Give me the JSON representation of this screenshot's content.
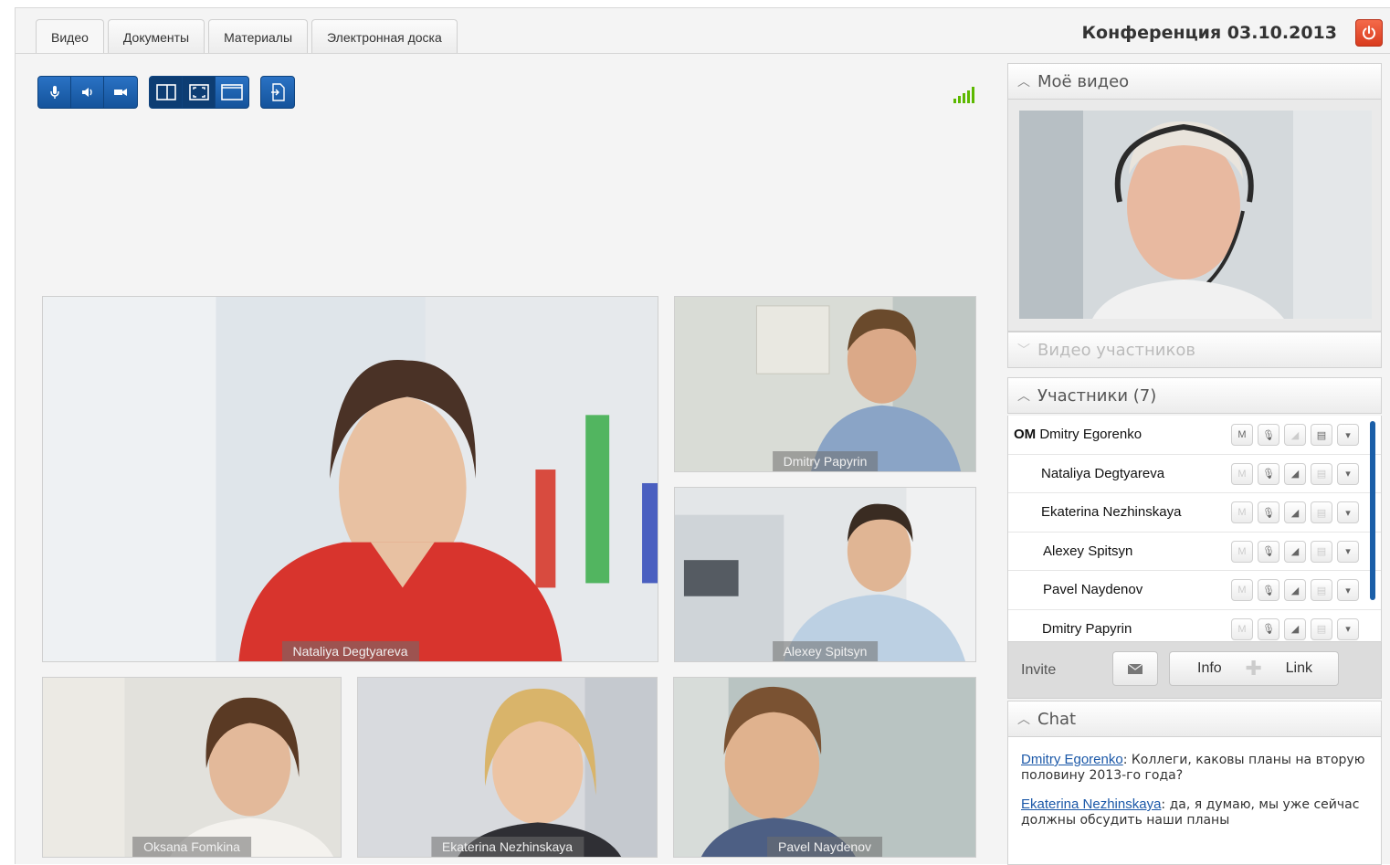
{
  "tabs": [
    {
      "label": "Видео"
    },
    {
      "label": "Документы"
    },
    {
      "label": "Материалы"
    },
    {
      "label": "Электронная доска"
    }
  ],
  "conference_title": "Конференция 03.10.2013",
  "videos": [
    {
      "name": "Nataliya Degtyareva"
    },
    {
      "name": "Dmitry Papyrin"
    },
    {
      "name": "Alexey Spitsyn"
    },
    {
      "name": "Oksana Fomkina"
    },
    {
      "name": "Ekaterina Nezhinskaya"
    },
    {
      "name": "Pavel Naydenov"
    }
  ],
  "panel": {
    "my_video": "Моё видео",
    "participant_video": "Видео участников",
    "participants_header": "Участники (7)",
    "participants": [
      {
        "prefix": "OM",
        "name": "Dmitry Egorenko"
      },
      {
        "prefix": "",
        "name": "Nataliya Degtyareva"
      },
      {
        "prefix": "",
        "name": "Ekaterina Nezhinskaya"
      },
      {
        "prefix": "",
        "name": "Alexey Spitsyn"
      },
      {
        "prefix": "",
        "name": "Pavel Naydenov"
      },
      {
        "prefix": "",
        "name": "Dmitry Papyrin"
      }
    ],
    "participant_control_letter": "M",
    "invite_label": "Invite",
    "info_label": "Info",
    "link_label": "Link",
    "chat_header": "Chat",
    "chat": [
      {
        "author": "Dmitry Egorenko",
        "text": ": Коллеги, каковы планы на вторую половину 2013-го года?"
      },
      {
        "author": "Ekaterina Nezhinskaya",
        "text": ": да, я думаю, мы уже сейчас должны обсудить наши планы"
      }
    ]
  },
  "colors": {
    "toolbar_blue": "#1a5fb0",
    "signal_green": "#5cb800",
    "power_red": "#e04a2a",
    "link_blue": "#1b58a8"
  },
  "signal_level": 5
}
